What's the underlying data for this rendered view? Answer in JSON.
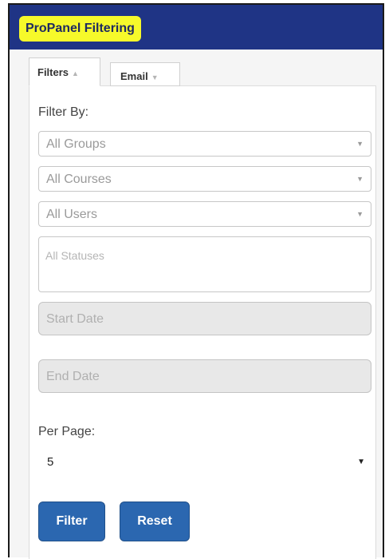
{
  "header": {
    "title": "ProPanel Filtering"
  },
  "tabs": [
    {
      "label": "Filters",
      "caret": "▲"
    },
    {
      "label": "Email",
      "caret": "▼"
    }
  ],
  "filter": {
    "filter_by_label": "Filter By:",
    "groups": "All Groups",
    "courses": "All Courses",
    "users": "All Users",
    "statuses": "All Statuses",
    "start_date": "Start Date",
    "end_date": "End Date",
    "select_arrow": "▼"
  },
  "per_page": {
    "label": "Per Page:",
    "value": "5",
    "arrow": "▼"
  },
  "buttons": {
    "filter": "Filter",
    "reset": "Reset"
  },
  "colors": {
    "header_bg": "#1f3485",
    "highlight": "#f6f92a",
    "button": "#2b67b0"
  }
}
